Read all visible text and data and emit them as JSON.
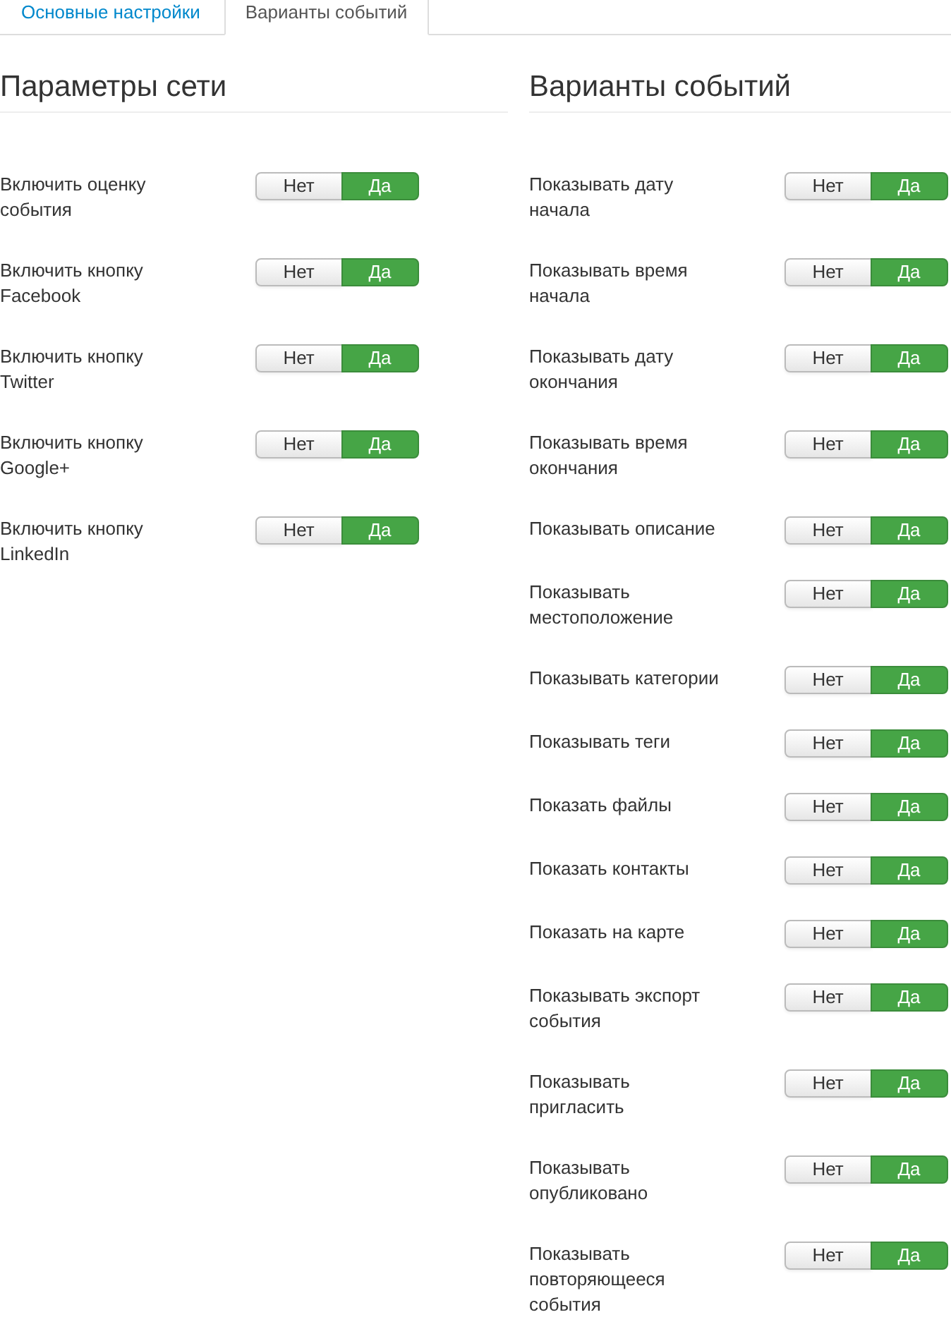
{
  "tabs": [
    {
      "label": "Основные настройки",
      "selected": false
    },
    {
      "label": "Варианты событий",
      "selected": true
    }
  ],
  "sections": [
    {
      "title": "Параметры сети",
      "settings": [
        {
          "label": "Включить оценку события",
          "options": [
            {
              "label": "Нет",
              "selected": false
            },
            {
              "label": "Да",
              "selected": true
            }
          ]
        },
        {
          "label": "Включить кнопку Facebook",
          "options": [
            {
              "label": "Нет",
              "selected": false
            },
            {
              "label": "Да",
              "selected": true
            }
          ]
        },
        {
          "label": "Включить кнопку Twitter",
          "options": [
            {
              "label": "Нет",
              "selected": false
            },
            {
              "label": "Да",
              "selected": true
            }
          ]
        },
        {
          "label": "Включить кнопку Google+",
          "options": [
            {
              "label": "Нет",
              "selected": false
            },
            {
              "label": "Да",
              "selected": true
            }
          ]
        },
        {
          "label": "Включить кнопку LinkedIn",
          "options": [
            {
              "label": "Нет",
              "selected": false
            },
            {
              "label": "Да",
              "selected": true
            }
          ]
        }
      ]
    },
    {
      "title": "Варианты событий",
      "settings": [
        {
          "label": "Показывать дату начала",
          "options": [
            {
              "label": "Нет",
              "selected": false
            },
            {
              "label": "Да",
              "selected": true
            }
          ]
        },
        {
          "label": "Показывать время начала",
          "options": [
            {
              "label": "Нет",
              "selected": false
            },
            {
              "label": "Да",
              "selected": true
            }
          ]
        },
        {
          "label": "Показывать дату окончания",
          "options": [
            {
              "label": "Нет",
              "selected": false
            },
            {
              "label": "Да",
              "selected": true
            }
          ]
        },
        {
          "label": "Показывать время окончания",
          "options": [
            {
              "label": "Нет",
              "selected": false
            },
            {
              "label": "Да",
              "selected": true
            }
          ]
        },
        {
          "label": "Показывать описание",
          "options": [
            {
              "label": "Нет",
              "selected": false
            },
            {
              "label": "Да",
              "selected": true
            }
          ]
        },
        {
          "label": "Показывать местоположение",
          "options": [
            {
              "label": "Нет",
              "selected": false
            },
            {
              "label": "Да",
              "selected": true
            }
          ]
        },
        {
          "label": "Показывать категории",
          "options": [
            {
              "label": "Нет",
              "selected": false
            },
            {
              "label": "Да",
              "selected": true
            }
          ]
        },
        {
          "label": "Показывать теги",
          "options": [
            {
              "label": "Нет",
              "selected": false
            },
            {
              "label": "Да",
              "selected": true
            }
          ]
        },
        {
          "label": "Показать файлы",
          "options": [
            {
              "label": "Нет",
              "selected": false
            },
            {
              "label": "Да",
              "selected": true
            }
          ]
        },
        {
          "label": "Показать контакты",
          "options": [
            {
              "label": "Нет",
              "selected": false
            },
            {
              "label": "Да",
              "selected": true
            }
          ]
        },
        {
          "label": "Показать на карте",
          "options": [
            {
              "label": "Нет",
              "selected": false
            },
            {
              "label": "Да",
              "selected": true
            }
          ]
        },
        {
          "label": "Показывать экспорт события",
          "options": [
            {
              "label": "Нет",
              "selected": false
            },
            {
              "label": "Да",
              "selected": true
            }
          ]
        },
        {
          "label": "Показывать пригласить",
          "options": [
            {
              "label": "Нет",
              "selected": false
            },
            {
              "label": "Да",
              "selected": true
            }
          ]
        },
        {
          "label": "Показывать опубликовано",
          "options": [
            {
              "label": "Нет",
              "selected": false
            },
            {
              "label": "Да",
              "selected": true
            }
          ]
        },
        {
          "label": "Показывать повторяющееся события",
          "options": [
            {
              "label": "Нет",
              "selected": false
            },
            {
              "label": "Да",
              "selected": true
            }
          ]
        }
      ]
    }
  ]
}
